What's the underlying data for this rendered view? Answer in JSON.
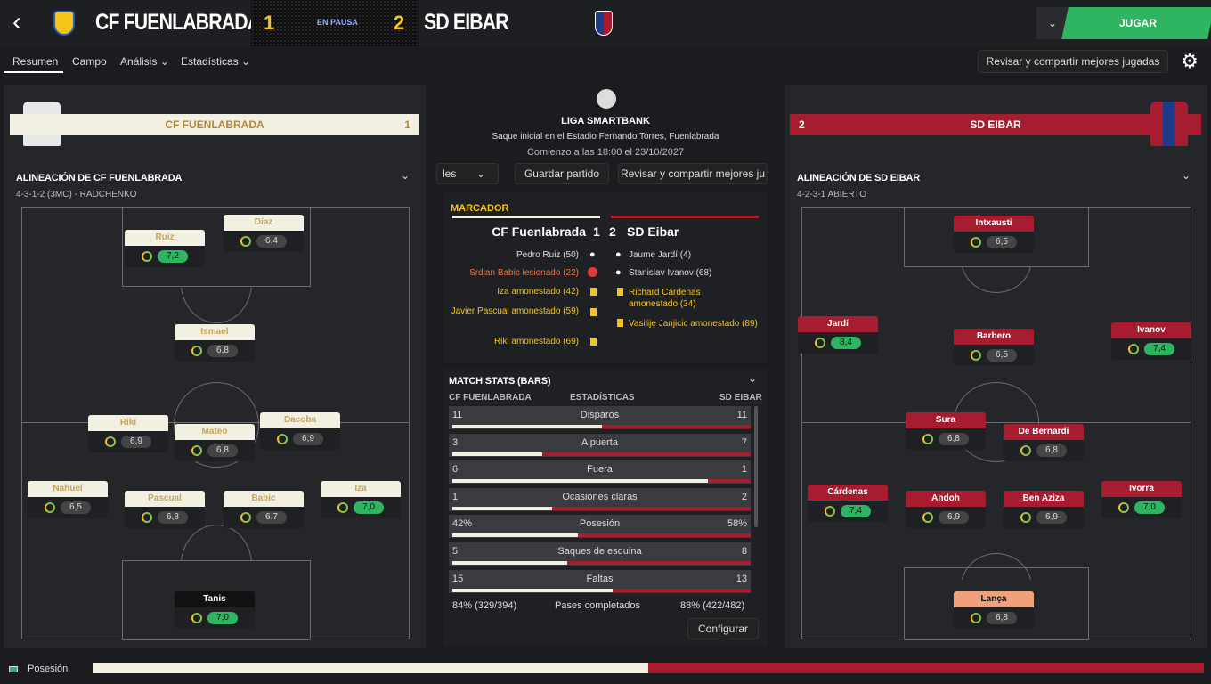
{
  "header": {
    "home_team": "CF FUENLABRADA",
    "away_team": "SD EIBAR",
    "home_score": "1",
    "away_score": "2",
    "status": "EN PAUSA",
    "play_label": "JUGAR"
  },
  "nav": {
    "tabs": [
      "Resumen",
      "Campo",
      "Análisis",
      "Estadísticas"
    ],
    "active": "Resumen",
    "review_label": "Revisar y compartir mejores jugadas"
  },
  "home_bar": {
    "name": "CF FUENLABRADA",
    "score": "1"
  },
  "away_bar": {
    "name": "SD EIBAR",
    "score": "2"
  },
  "home_lineup": {
    "title": "ALINEACIÓN DE CF FUENLABRADA",
    "formation": "4-3-1-2 (3MC) - RADCHENKO",
    "players": [
      {
        "name": "Ruiz",
        "rating": "7,2",
        "good": true
      },
      {
        "name": "Díaz",
        "rating": "6,4",
        "good": false
      },
      {
        "name": "Ismael",
        "rating": "6,8",
        "good": false
      },
      {
        "name": "Riki",
        "rating": "6,9",
        "good": false
      },
      {
        "name": "Mateo",
        "rating": "6,8",
        "good": false
      },
      {
        "name": "Dacoba",
        "rating": "6,9",
        "good": false
      },
      {
        "name": "Nahuel",
        "rating": "6,5",
        "good": false
      },
      {
        "name": "Pascual",
        "rating": "6,8",
        "good": false
      },
      {
        "name": "Babic",
        "rating": "6,7",
        "good": false
      },
      {
        "name": "Iza",
        "rating": "7,0",
        "good": true
      },
      {
        "name": "Tanis",
        "rating": "7,0",
        "good": true
      }
    ]
  },
  "away_lineup": {
    "title": "ALINEACIÓN DE SD EIBAR",
    "formation": "4-2-3-1 ABIERTO",
    "players": [
      {
        "name": "Intxausti",
        "rating": "6,5",
        "good": false
      },
      {
        "name": "Jardí",
        "rating": "8,4",
        "good": true
      },
      {
        "name": "Barbero",
        "rating": "6,5",
        "good": false
      },
      {
        "name": "Ivanov",
        "rating": "7,4",
        "good": true
      },
      {
        "name": "Sura",
        "rating": "6,8",
        "good": false
      },
      {
        "name": "De Bernardi",
        "rating": "6,8",
        "good": false
      },
      {
        "name": "Cárdenas",
        "rating": "7,4",
        "good": true
      },
      {
        "name": "Andoh",
        "rating": "6,9",
        "good": false
      },
      {
        "name": "Ben Aziza",
        "rating": "6,9",
        "good": false
      },
      {
        "name": "Ivorra",
        "rating": "7,0",
        "good": true
      },
      {
        "name": "Lança",
        "rating": "6,8",
        "good": false
      }
    ]
  },
  "match_info": {
    "league": "LIGA SMARTBANK",
    "venue": "Saque inicial en el Estadio Fernando Torres, Fuenlabrada",
    "time": "Comienzo a las 18:00 el 23/10/2027"
  },
  "mid_buttons": {
    "partial": "les",
    "save": "Guardar partido",
    "review": "Revisar y compartir mejores ju"
  },
  "scoreboard": {
    "title": "MARCADOR",
    "home": "CF Fuenlabrada",
    "home_score": "1",
    "away_score": "2",
    "away": "SD Eibar",
    "home_events": [
      "Pedro Ruiz (50)",
      "Srdjan Babic lesionado (22)",
      "Iza amonestado (42)",
      "Javier Pascual amonestado (59)",
      "Riki amonestado (69)"
    ],
    "away_events": [
      "Jaume Jardí (4)",
      "Stanislav Ivanov (68)",
      "Richard Cárdenas amonestado (34)",
      "Vasilije Janjicic amonestado (89)"
    ]
  },
  "stats": {
    "title": "MATCH STATS (BARS)",
    "home": "CF FUENLABRADA",
    "mid": "ESTADÍSTICAS",
    "away": "SD EIBAR",
    "rows": [
      {
        "label": "Disparos",
        "home": "11",
        "away": "11",
        "hp": 0.5
      },
      {
        "label": "A puerta",
        "home": "3",
        "away": "7",
        "hp": 0.3
      },
      {
        "label": "Fuera",
        "home": "6",
        "away": "1",
        "hp": 0.857
      },
      {
        "label": "Ocasiones claras",
        "home": "1",
        "away": "2",
        "hp": 0.333
      },
      {
        "label": "Posesión",
        "home": "42%",
        "away": "58%",
        "hp": 0.42
      },
      {
        "label": "Saques de esquina",
        "home": "5",
        "away": "8",
        "hp": 0.385
      },
      {
        "label": "Faltas",
        "home": "15",
        "away": "13",
        "hp": 0.536
      }
    ],
    "passes_home": "84% (329/394)",
    "passes_label": "Pases completados",
    "passes_away": "88% (422/482)",
    "config": "Configurar"
  },
  "footer": {
    "label": "Posesión",
    "home_share": 0.5
  },
  "colors": {
    "home": "#f2efe3",
    "away": "#a71d2f",
    "green": "#2fb561",
    "yellow": "#f5c518"
  }
}
